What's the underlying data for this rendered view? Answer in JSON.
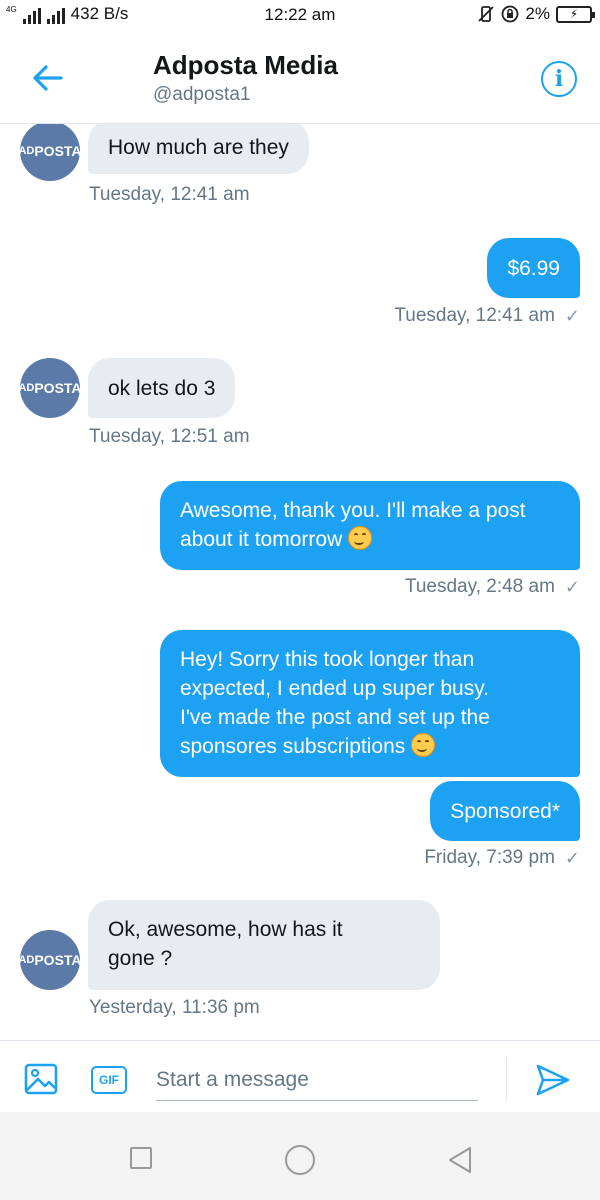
{
  "status_bar": {
    "network": "4G",
    "speed": "432 B/s",
    "time": "12:22 am",
    "battery": "2%"
  },
  "header": {
    "title": "Adposta Media",
    "handle": "@adposta1",
    "info_label": "i"
  },
  "contact": {
    "avatar_text_small": "AD",
    "avatar_text_big": "POSTA"
  },
  "messages": [
    {
      "direction": "in",
      "text": "How much are they",
      "timestamp": "Tuesday, 12:41 am"
    },
    {
      "direction": "out",
      "text": "$6.99",
      "timestamp": "Tuesday, 12:41 am"
    },
    {
      "direction": "in",
      "text": "ok lets do 3",
      "timestamp": "Tuesday, 12:51 am"
    },
    {
      "direction": "out",
      "text_line1": "Awesome, thank you. I'll make a post",
      "text_line2": "about it tomorrow",
      "timestamp": "Tuesday, 2:48 am"
    },
    {
      "direction": "out",
      "text_line1": "Hey! Sorry this took longer than",
      "text_line2": "expected, I ended up super busy.",
      "text_line3": "I've made the post and set up the",
      "text_line4": "sponsores subscriptions"
    },
    {
      "direction": "out",
      "text": "Sponsored*",
      "timestamp": "Friday, 7:39 pm"
    },
    {
      "direction": "in",
      "text_line1": "Ok, awesome, how has it",
      "text_line2": "gone ?",
      "timestamp": "Yesterday, 11:36 pm"
    }
  ],
  "composer": {
    "placeholder": "Start a message",
    "gif_label": "GIF"
  },
  "colors": {
    "accent": "#1da1f2",
    "incoming_bubble": "#e6ecf0",
    "timestamp": "#657786",
    "avatar": "#5b7aa8"
  },
  "icons": {
    "back": "arrow-left-icon",
    "info": "info-icon",
    "image": "image-icon",
    "gif": "gif-icon",
    "send": "send-icon",
    "read_receipt": "checkmark-icon"
  }
}
